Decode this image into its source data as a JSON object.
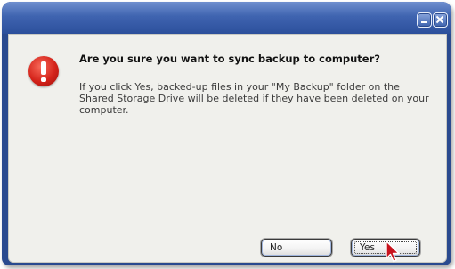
{
  "dialog": {
    "heading": "Are you sure you want to sync backup to computer?",
    "message": "If you click Yes, backed-up files in your \"My Backup\" folder on the Shared Storage Drive will be deleted if they have been deleted on your computer.",
    "icon": "error-alert-icon",
    "icon_color": "#d4231a"
  },
  "buttons": {
    "no_label": "No",
    "yes_label": "Yes"
  },
  "titlebar": {
    "minimize_icon": "minimize-icon",
    "close_icon": "close-icon",
    "color": "#3f64b0"
  }
}
